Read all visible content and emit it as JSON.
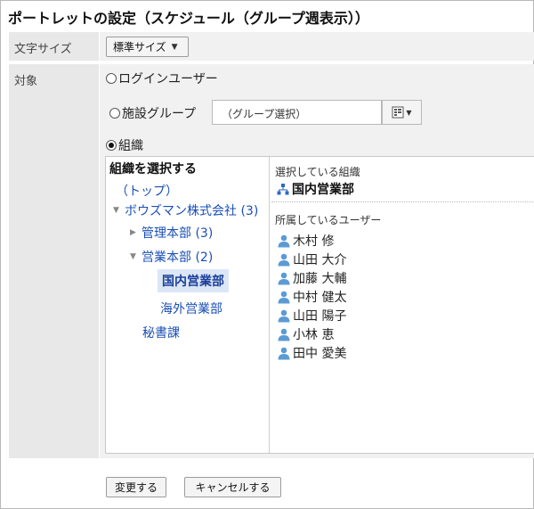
{
  "page": {
    "title": "ポートレットの設定（スケジュール（グループ週表示））"
  },
  "font_size_row": {
    "label": "文字サイズ",
    "selected": "標準サイズ"
  },
  "target_row": {
    "label": "対象",
    "option_login_user": "ログインユーザー",
    "option_facility_group": "施設グループ",
    "group_select_placeholder": "（グループ選択）",
    "option_organization": "組織",
    "selected_option": "組織"
  },
  "org_selector": {
    "heading": "組織を選択する",
    "tree": [
      {
        "label": "（トップ）",
        "toggle": ""
      },
      {
        "label": "ボウズマン株式会社 (3)",
        "toggle": "expanded"
      },
      {
        "label": "管理本部 (3)",
        "toggle": "collapsed"
      },
      {
        "label": "営業本部 (2)",
        "toggle": "expanded"
      },
      {
        "label": "国内営業部",
        "toggle": "",
        "selected": true
      },
      {
        "label": "海外営業部",
        "toggle": ""
      },
      {
        "label": "秘書課",
        "toggle": ""
      }
    ],
    "selected_caption": "選択している組織",
    "selected_org": "国内営業部",
    "members_caption": "所属しているユーザー",
    "members": [
      "木村 修",
      "山田 大介",
      "加藤 大輔",
      "中村 健太",
      "山田 陽子",
      "小林 恵",
      "田中 愛美"
    ]
  },
  "actions": {
    "change_label": "変更する",
    "cancel_label": "キャンセルする"
  },
  "colors": {
    "label_bg": "#e8e8e8",
    "value_bg": "#f1f1f1",
    "link": "#1a4fb5",
    "selected_bg": "#dce7f6",
    "user_icon": "#5b9bd5"
  },
  "icons": {
    "group_picker": "group-list-icon",
    "org_structure": "org-tree-icon",
    "user": "user-icon"
  }
}
